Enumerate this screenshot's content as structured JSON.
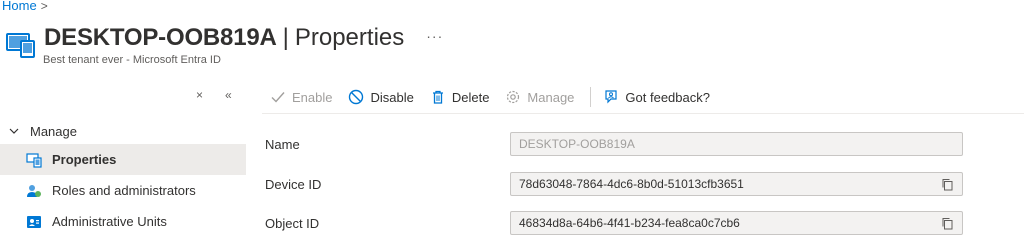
{
  "breadcrumb": {
    "home": "Home",
    "separator": ">"
  },
  "header": {
    "device_name": "DESKTOP-OOB819A",
    "separator": "|",
    "page_title": "Properties",
    "more": "···",
    "subtitle": "Best tenant ever - Microsoft Entra ID"
  },
  "collapse": {
    "close_glyph": "×",
    "collapse_glyph": "«"
  },
  "toolbar": {
    "enable": "Enable",
    "disable": "Disable",
    "delete": "Delete",
    "manage": "Manage",
    "feedback": "Got feedback?"
  },
  "sidebar": {
    "group": "Manage",
    "items": [
      {
        "label": "Properties",
        "icon": "device-icon",
        "active": true
      },
      {
        "label": "Roles and administrators",
        "icon": "roles-icon",
        "active": false
      },
      {
        "label": "Administrative Units",
        "icon": "admin-units-icon",
        "active": false
      }
    ]
  },
  "form": {
    "name": {
      "label": "Name",
      "value": "DESKTOP-OOB819A"
    },
    "device_id": {
      "label": "Device ID",
      "value": "78d63048-7864-4dc6-8b0d-51013cfb3651"
    },
    "object_id": {
      "label": "Object ID",
      "value": "46834d8a-64b6-4f41-b234-fea8ca0c7cb6"
    }
  },
  "colors": {
    "accent": "#0078d4",
    "active_bg": "#edebe9",
    "field_bg": "#f3f2f1"
  }
}
